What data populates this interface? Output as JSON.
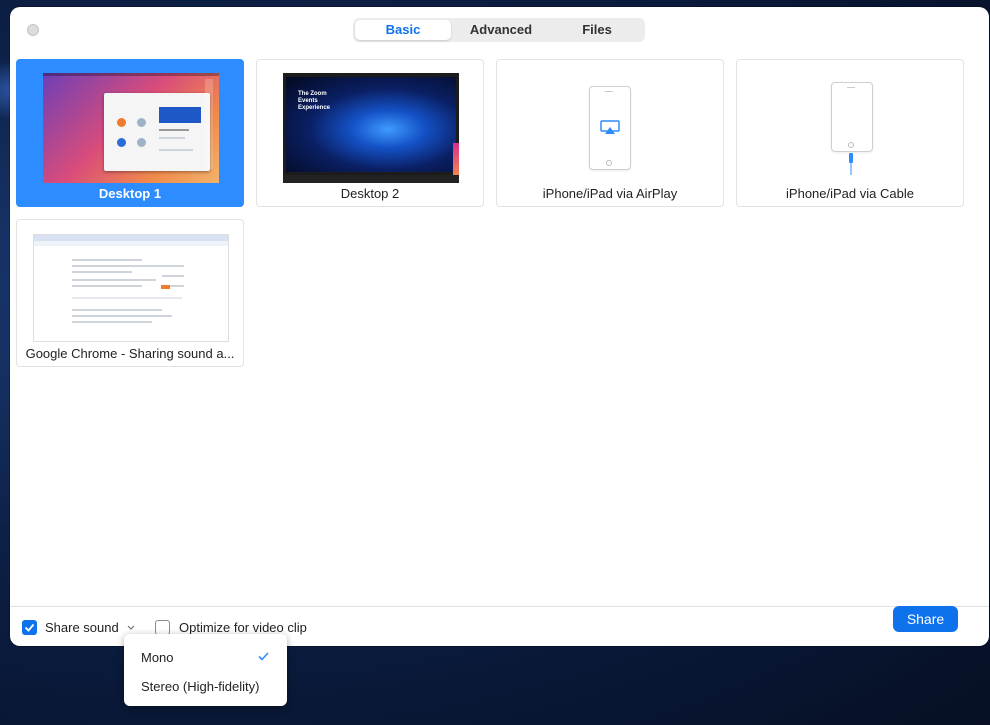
{
  "tabs": {
    "basic": "Basic",
    "advanced": "Advanced",
    "files": "Files"
  },
  "tiles": {
    "desktop1": "Desktop 1",
    "desktop2": "Desktop 2",
    "airplay": "iPhone/iPad via AirPlay",
    "cable": "iPhone/iPad via Cable",
    "chrome": "Google Chrome - Sharing sound a..."
  },
  "desktop2_thumb": {
    "title_text": "The Zoom Events Experience"
  },
  "footer": {
    "share_sound": "Share sound",
    "share_sound_checked": true,
    "optimize": "Optimize for video clip",
    "optimize_checked": false,
    "share_button": "Share"
  },
  "dropdown": {
    "items": [
      {
        "label": "Mono",
        "selected": true
      },
      {
        "label": "Stereo (High-fidelity)",
        "selected": false
      }
    ]
  },
  "colors": {
    "accent": "#0e72ed",
    "selected_tile": "#2d8cff"
  }
}
